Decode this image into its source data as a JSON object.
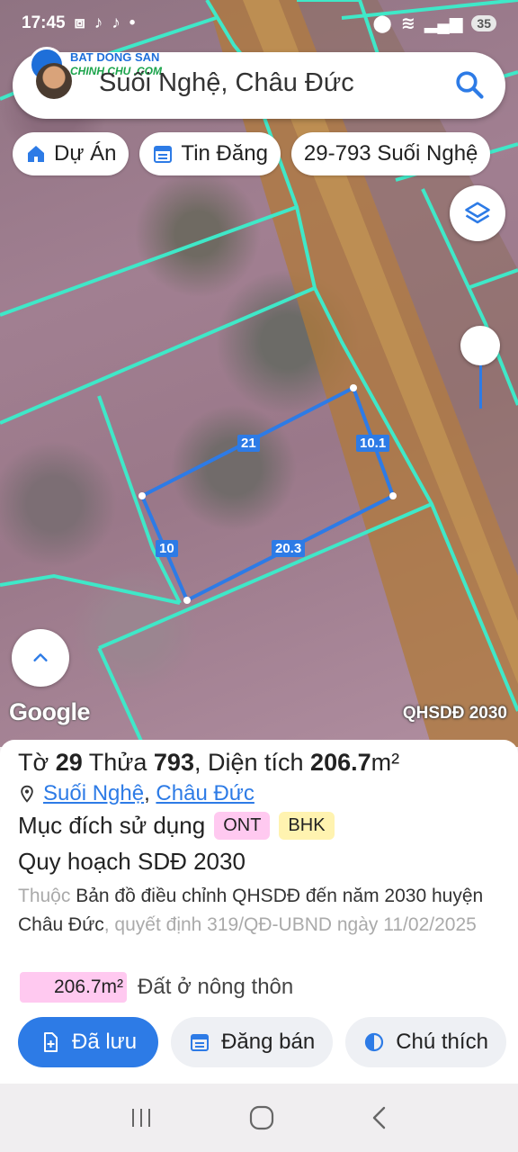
{
  "status_bar": {
    "time": "17:45",
    "battery": "35"
  },
  "logo": {
    "line1": "BAT DONG SAN",
    "line2": "CHINH CHU .COM"
  },
  "search": {
    "query": "Suối Nghệ, Châu Đức"
  },
  "chips": [
    {
      "label": "Dự Án",
      "icon": "home-icon"
    },
    {
      "label": "Tin Đăng",
      "icon": "calendar-icon"
    },
    {
      "label": "29-793 Suối Nghệ",
      "icon": ""
    }
  ],
  "map": {
    "google_label": "Google",
    "layer_label": "QHSDĐ 2030",
    "dimensions": {
      "top": "21",
      "right": "10.1",
      "left": "10",
      "bottom": "20.3"
    }
  },
  "parcel": {
    "to_label": "Tờ",
    "to_number": "29",
    "thua_label": "Thửa",
    "thua_number": "793",
    "area_label": ", Diện tích",
    "area_value": "206.7",
    "area_unit": "m²",
    "commune": "Suối Nghệ",
    "district": "Châu Đức",
    "address_separator": ",",
    "purpose_label": "Mục đích sử dụng",
    "purpose_codes": [
      "ONT",
      "BHK"
    ],
    "plan_heading": "Quy hoạch SDĐ 2030",
    "plan_prefix": "Thuộc",
    "plan_doc": "Bản đồ điều chỉnh QHSDĐ đến năm 2030 huyện Châu Đức",
    "plan_suffix": ", quyết định 319/QĐ-UBND ngày 11/02/2025",
    "area_badge": "206.7m²",
    "area_type": "Đất ở nông thôn"
  },
  "actions": {
    "saved": "Đã lưu",
    "post": "Đăng bán",
    "legend": "Chú thích"
  },
  "colors": {
    "accent": "#2d7be6",
    "ont_badge": "#ffc9f0",
    "bhk_badge": "#fff3b0",
    "boundary": "#3fe8c8"
  }
}
